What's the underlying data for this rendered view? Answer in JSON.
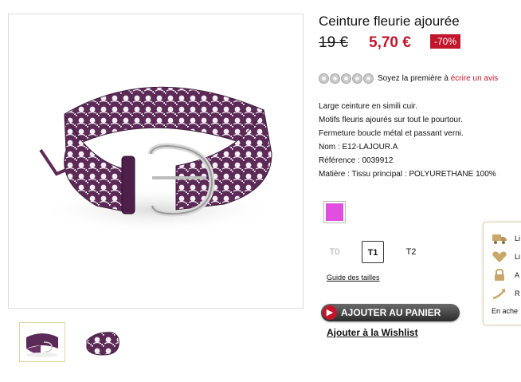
{
  "product": {
    "title": "Ceinture fleurie ajourée",
    "old_price": "19 €",
    "new_price": "5,70 €",
    "discount": "-70%"
  },
  "rating": {
    "stars_filled": 0,
    "stars_total": 5,
    "text": "Soyez la première à",
    "link": "écrire un avis"
  },
  "description": [
    "Large ceinture en simili cuir.",
    "Motifs fleuris ajourés sur tout le pourtour.",
    "Fermeture boucle métal et passant verni.",
    "Nom :  E12-LAJOUR.A",
    "Référence :  0039912",
    "Matière :  Tissu principal : POLYURETHANE 100%"
  ],
  "color_swatch": {
    "color": "#e14fe0"
  },
  "sizes": [
    {
      "label": "T0",
      "state": "disabled"
    },
    {
      "label": "T1",
      "state": "selected"
    },
    {
      "label": "T2",
      "state": "available"
    }
  ],
  "size_guide": "Guide des tailles",
  "cart_button": "AJOUTER AU PANIER",
  "wishlist": "Ajouter à la Wishlist",
  "side_panel": {
    "items": [
      {
        "icon": "truck-icon",
        "text": "Li"
      },
      {
        "icon": "heart-icon",
        "text": "Li"
      },
      {
        "icon": "lock-icon",
        "text": "A"
      },
      {
        "icon": "return-arrow-icon",
        "text": "R"
      }
    ],
    "footer": "En ache"
  },
  "colors": {
    "accent": "#c2162b",
    "belt": "#5c2a57",
    "panel_border": "#e3d6b4"
  }
}
